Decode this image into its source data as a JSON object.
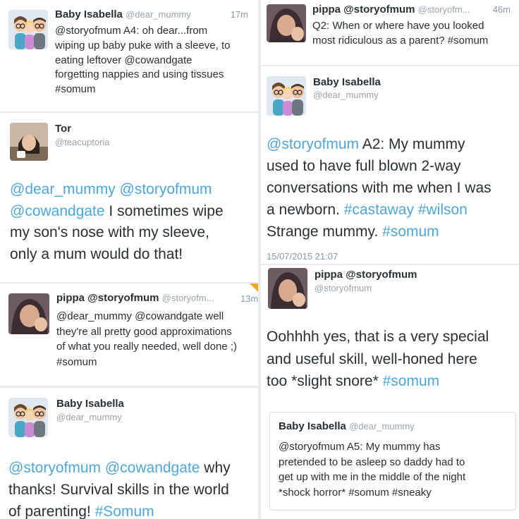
{
  "colors": {
    "link": "#4ea6d8",
    "muted": "#9aa3aa",
    "text": "#292f33"
  },
  "t1": {
    "name": "Baby Isabella",
    "handle": "@dear_mummy",
    "time": "17m",
    "lines": [
      "@storyofmum A4: oh dear...from",
      "wiping up baby puke with a sleeve, to",
      "eating leftover @cowandgate",
      "forgetting nappies and using tissues",
      "#somum"
    ]
  },
  "t2": {
    "name": "Tor",
    "handle": "@teacuptoria",
    "l1_m1": "@dear_mummy",
    "l1_m2": "@storyofmum",
    "l2_m": "@cowandgate",
    "l2_rest": " I sometimes wipe",
    "l3": "my son's nose with my sleeve,",
    "l4": "only a mum would do that!"
  },
  "t3": {
    "name": "pippa",
    "handle": "@storyofmum",
    "handle2": "@storyofm...",
    "time": "13m",
    "lines": [
      "@dear_mummy @cowandgate well",
      "they're all pretty good approximations",
      "of what you really needed, well done ;)",
      "#somum"
    ]
  },
  "t4": {
    "name": "Baby Isabella",
    "handle": "@dear_mummy",
    "l1_m1": "@storyofmum",
    "l1_m2": "@cowandgate",
    "l1_rest": " why",
    "l2": "thanks! Survival skills in the world",
    "l3_pre": "of parenting! ",
    "l3_tag": "#Somum"
  },
  "t5": {
    "name": "pippa",
    "handle": "@storyofmum",
    "handle2": "@storyofm...",
    "time": "46m",
    "lines": [
      "Q2: When or where have you looked",
      "most ridiculous as a parent? #somum"
    ]
  },
  "t6": {
    "name": "Baby Isabella",
    "handle": "@dear_mummy",
    "l1_m": "@storyofmum",
    "l1_rest": " A2: My mummy",
    "l2": "used to have full blown 2-way",
    "l3": "conversations with me when I was",
    "l4_pre": "a newborn. ",
    "l4_t1": "#castaway",
    "l4_t2": "#wilson",
    "l5_pre": "Strange mummy. ",
    "l5_t": "#somum",
    "date": "15/07/2015 21:07"
  },
  "t7": {
    "name": "pippa",
    "handle": "@storyofmum",
    "l1": "Oohhhh yes, that is a very special",
    "l2": "and useful skill, well-honed here",
    "l3_pre": "too *slight snore* ",
    "l3_t": "#somum"
  },
  "t8": {
    "name": "Baby Isabella",
    "handle": "@dear_mummy",
    "lines": [
      "@storyofmum A5: My mummy has",
      "pretended to be asleep so daddy had to",
      "get up with me in the middle of the night",
      "*shock horror* #somum #sneaky"
    ]
  }
}
